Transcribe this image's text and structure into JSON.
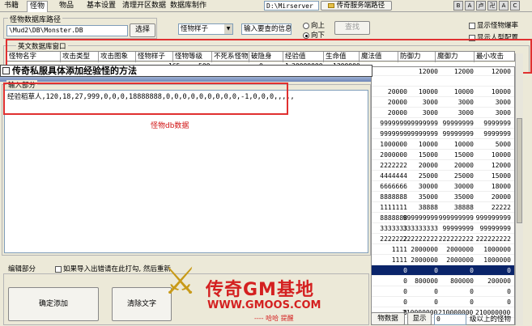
{
  "tabs": [
    "书籍",
    "怪物",
    "物品",
    "基本设置",
    "清理开区数据",
    "数据库制作"
  ],
  "server": {
    "path": "D:\\Mirserver",
    "open_button": "传奇服务端路径"
  },
  "toolbar_icons": [
    "B",
    "A",
    "卢",
    "卍",
    "A",
    "C"
  ],
  "db_path": {
    "label": "怪物数据库路径",
    "value": "\\Mud2\\DB\\Monster.DB",
    "select_button": "选择"
  },
  "search": {
    "combo_value": "怪物样子",
    "input_value": "输入要查的信息",
    "radio_up": "向上",
    "radio_down": "向下",
    "find_button": "查找"
  },
  "options": {
    "show_drop": "显示怪物爆率",
    "show_config": "显示人型配置"
  },
  "english_window": "英文数据库窗口",
  "columns": [
    "怪物名字",
    "攻击类型",
    "攻击图象",
    "怪物样子",
    "怪物等级",
    "不死系怪物",
    "破隐身",
    "经验值",
    "生命值",
    "魔法值",
    "防御力",
    "魔御力",
    "最小攻击"
  ],
  "first_row": [
    "",
    "",
    "",
    "165",
    "500",
    "",
    "0",
    "1",
    "30000000",
    "1200000"
  ],
  "annotation": "传奇私服具体添加经验怪的方法",
  "input_section": {
    "label": "输入部分",
    "text": "经验稻草人,120,18,27,999,0,0,0,18888888,0,0,0,0,0,0,0,0,0,-1,0,0,0,,,,,",
    "watermark": "怪物db数据"
  },
  "right_rows": [
    [
      "",
      "",
      "",
      ""
    ],
    [
      "20000",
      "10000",
      "10000",
      "10000"
    ],
    [
      "20000",
      "3000",
      "3000",
      "3000"
    ],
    [
      "20000",
      "3000",
      "3000",
      "3000"
    ],
    [
      "9999999",
      "99999999",
      "99999999",
      "9999999"
    ],
    [
      "9999999",
      "99999999",
      "99999999",
      "9999999"
    ],
    [
      "1000000",
      "10000",
      "10000",
      "5000"
    ],
    [
      "2000000",
      "15000",
      "15000",
      "10000"
    ],
    [
      "2222222",
      "20000",
      "20000",
      "12000"
    ],
    [
      "4444444",
      "25000",
      "25000",
      "15000"
    ],
    [
      "6666666",
      "30000",
      "30000",
      "18000"
    ],
    [
      "8888888",
      "35000",
      "35000",
      "20000"
    ],
    [
      "1111111",
      "38888",
      "38888",
      "22222"
    ],
    [
      "8888888",
      "999999999",
      "999999999",
      "999999999"
    ],
    [
      "3333333",
      "333333333",
      "99999999",
      "99999999"
    ],
    [
      "2222222",
      "222222222",
      "222222222",
      "222222222"
    ],
    [
      "1111",
      "2000000",
      "2000000",
      "1000000"
    ],
    [
      "1111",
      "2000000",
      "2000000",
      "1000000"
    ],
    [
      "0",
      "0",
      "0",
      "0"
    ],
    [
      "0",
      "800000",
      "800000",
      "200000"
    ],
    [
      "0",
      "0",
      "0",
      "0"
    ],
    [
      "0",
      "0",
      "0",
      "0"
    ],
    [
      "0",
      "2100000000",
      "2100000000",
      "2100000000"
    ]
  ],
  "right_header": [
    "",
    "12000",
    "12000",
    "12000"
  ],
  "edit_section": {
    "label": "编辑部分",
    "checkbox": "如果导入出错请在此打勾, 然后重新",
    "confirm": "确定添加",
    "clear": "清除文字"
  },
  "logo": {
    "title": "传奇GM基地",
    "url": "WWW.GMOOS.COM",
    "note": "---- 哈哈 提醒"
  },
  "bottom": {
    "data_btn": "物数据",
    "show_btn": "显示",
    "value": "0",
    "label": "级以上的怪物"
  },
  "colors": {
    "highlight": "#e03030",
    "selection": "#0a246a"
  }
}
